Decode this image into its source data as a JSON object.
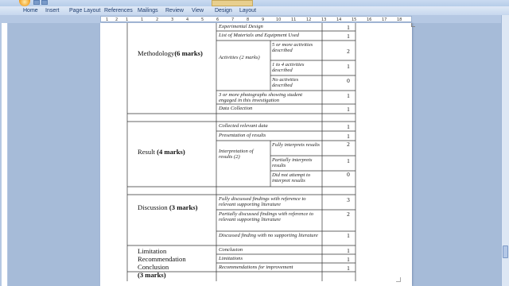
{
  "ribbon": {
    "tabs": [
      "Home",
      "Insert",
      "Page Layout",
      "References",
      "Mailings",
      "Review",
      "View",
      "Design",
      "Layout"
    ],
    "active_tab": "Home"
  },
  "ruler": {
    "marks": [
      "1",
      "2",
      "1",
      "1",
      "2",
      "3",
      "4",
      "5",
      "6",
      "7",
      "8",
      "9",
      "10",
      "11",
      "12",
      "13",
      "14",
      "15",
      "16",
      "17",
      "18"
    ]
  },
  "table": {
    "methodology": {
      "label": "Methodology",
      "marks": "(6 marks)",
      "rows": {
        "experimental_design": {
          "text": "Experimental Design",
          "score": "1"
        },
        "materials": {
          "text": "List of Materials and Equipment Used",
          "score": "1"
        },
        "activities_label": "Activities (2 marks)",
        "activities_1": {
          "text": "5 or more activities described",
          "score": "2"
        },
        "activities_2": {
          "text": "1 to 4 activities described",
          "score": "1"
        },
        "activities_3": {
          "text": "No activities described",
          "score": "0"
        },
        "photographs": {
          "text": "3 or more photographs showing student engaged in this investigation",
          "score": "1"
        },
        "data_collection": {
          "text": "Data Collection",
          "score": "1"
        }
      }
    },
    "result": {
      "label": "Result",
      "marks": "(4 marks)",
      "rows": {
        "collected": {
          "text": "Collected relevant data",
          "score": "1"
        },
        "presentation": {
          "text": "Presentation of results",
          "score": "1"
        },
        "interpretation_label": "Interpretation of results (2)",
        "interp_1": {
          "text": "Fully interprets results",
          "score": "2"
        },
        "interp_2": {
          "text": "Partially interprets results",
          "score": "1"
        },
        "interp_3": {
          "text": "Did not attempt to interpret results",
          "score": "0"
        }
      }
    },
    "discussion": {
      "label": "Discussion",
      "marks": "(3  marks)",
      "rows": {
        "fully": {
          "text": "Fully discussed findings with reference to relevant supporting literature",
          "score": "3"
        },
        "partially": {
          "text": "Partially discussed findings with reference to relevant supporting literature",
          "score": "2"
        },
        "no_support": {
          "text": "Discussed finding with no supporting literature",
          "score": "1"
        }
      }
    },
    "limitation": {
      "line1": "Limitation",
      "line2": "Recommendation",
      "line3": "Conclusion",
      "marks": "(3 marks)",
      "rows": {
        "conclusion": {
          "text": "Conclusion",
          "score": "1"
        },
        "limitations": {
          "text": "Limitations",
          "score": "1"
        },
        "recommendations": {
          "text": "Recommendations for improvement",
          "score": "1"
        }
      }
    }
  }
}
